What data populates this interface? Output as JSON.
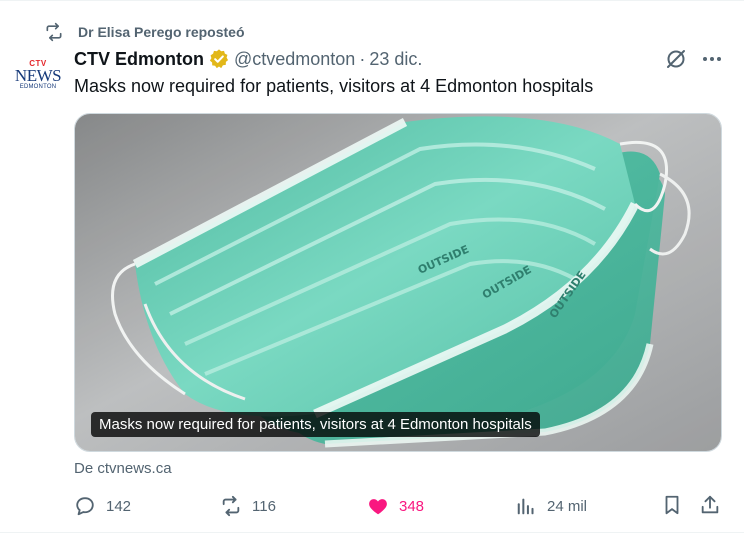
{
  "repost": {
    "text": "Dr Elisa Perego reposteó"
  },
  "author": {
    "name": "CTV Edmonton",
    "handle": "@ctvedmonton",
    "separator": "·",
    "date": "23 dic.",
    "avatar_ctv": "CTV",
    "avatar_news": "NEWS",
    "avatar_city": "EDMONTON"
  },
  "tweet": {
    "text": "Masks now required for patients, visitors at 4 Edmonton hospitals"
  },
  "media": {
    "caption": "Masks now required for patients, visitors at 4 Edmonton hospitals",
    "mask_print": "OUTSIDE"
  },
  "card": {
    "source": "De ctvnews.ca"
  },
  "actions": {
    "replies": "142",
    "reposts": "116",
    "likes": "348",
    "views": "24 mil"
  },
  "colors": {
    "like_accent": "#f91880",
    "muted": "#536471",
    "verified_gold": "#e2b719",
    "mask_green": "#6ccfb7"
  },
  "icons": {
    "repost": "repost-icon",
    "verified": "verified-badge-icon",
    "grok": "grok-icon",
    "more": "more-icon",
    "reply": "reply-icon",
    "like": "heart-icon",
    "views": "views-icon",
    "bookmark": "bookmark-icon",
    "share": "share-icon"
  }
}
